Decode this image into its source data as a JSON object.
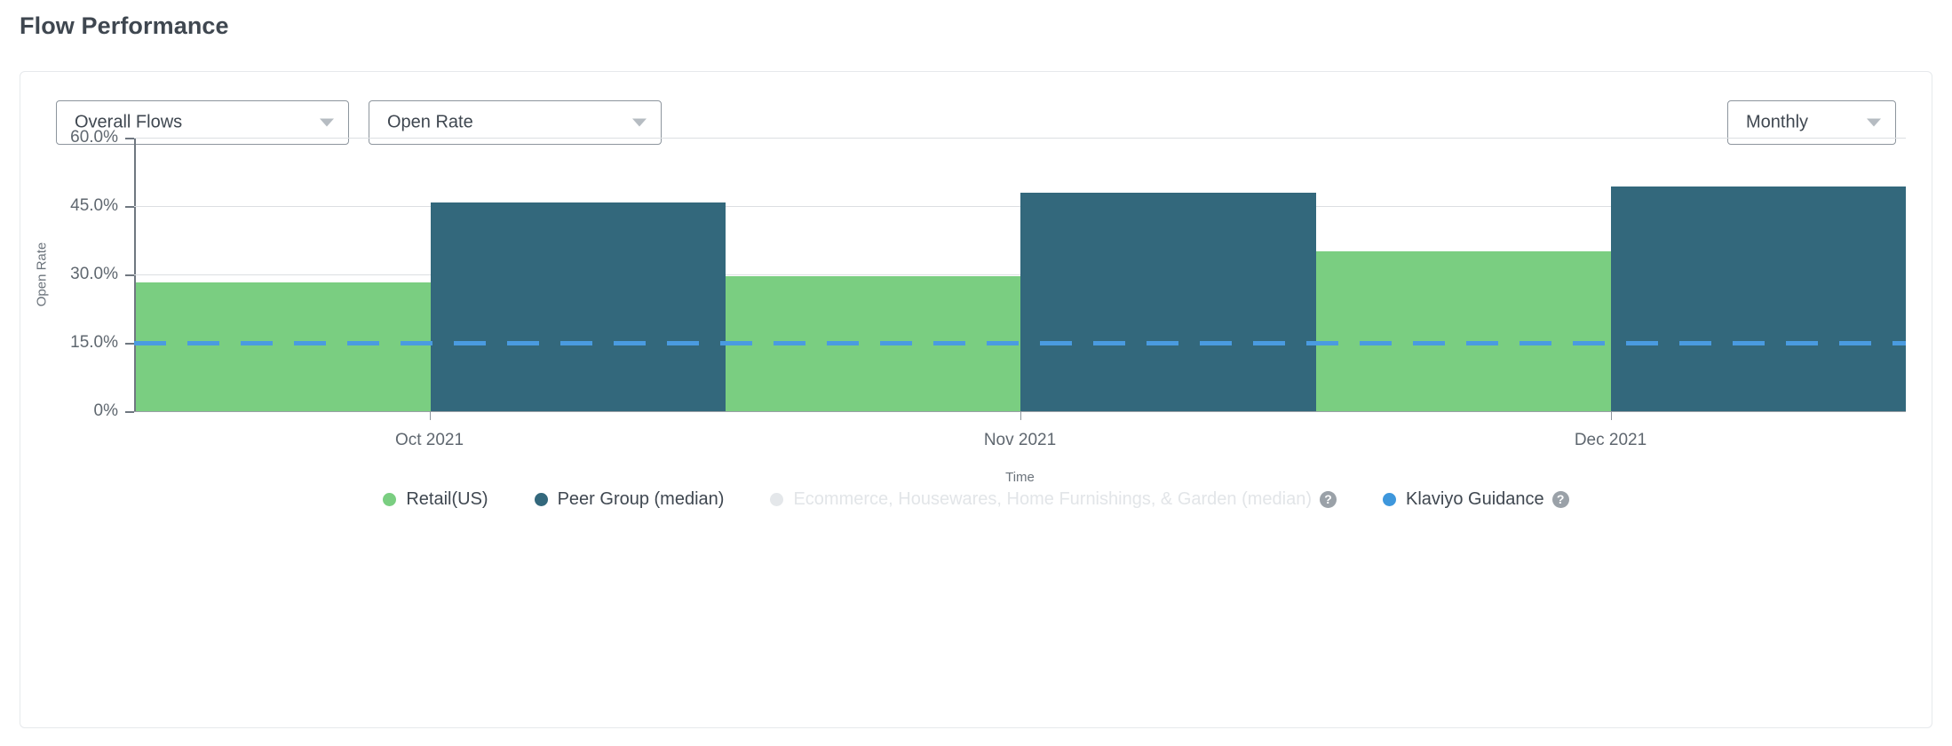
{
  "page_title": "Flow Performance",
  "toolbar": {
    "flows_select": "Overall Flows",
    "metric_select": "Open Rate",
    "interval_select": "Monthly"
  },
  "legend": [
    {
      "label": "Retail(US)",
      "color": "#7ACE81",
      "muted": false,
      "help": ""
    },
    {
      "label": "Peer Group (median)",
      "color": "#33687C",
      "muted": false,
      "help": ""
    },
    {
      "label": "Ecommerce, Housewares, Home Furnishings, & Garden (median)",
      "color": "#E4E7EA",
      "muted": true,
      "help": "?"
    },
    {
      "label": "Klaviyo Guidance",
      "color": "#3E97DC",
      "muted": false,
      "help": "?"
    }
  ],
  "chart_data": {
    "type": "bar",
    "title": "",
    "xlabel": "Time",
    "ylabel": "Open Rate",
    "categories": [
      "Oct 2021",
      "Nov 2021",
      "Dec 2021"
    ],
    "ylim": [
      0,
      60
    ],
    "ytick_labels": [
      "0%",
      "15.0%",
      "30.0%",
      "45.0%",
      "60.0%"
    ],
    "ytick_values": [
      0,
      15,
      30,
      45,
      60
    ],
    "grid": true,
    "legend_position": "bottom",
    "series": [
      {
        "name": "Retail(US)",
        "color": "#7ACE81",
        "values": [
          28.3,
          29.7,
          35.0
        ]
      },
      {
        "name": "Peer Group (median)",
        "color": "#33687C",
        "values": [
          45.8,
          48.0,
          49.2
        ]
      }
    ],
    "reference_lines": [
      {
        "name": "Klaviyo Guidance",
        "value": 15.0,
        "color": "#4A9BE0",
        "style": "dashed"
      }
    ]
  }
}
